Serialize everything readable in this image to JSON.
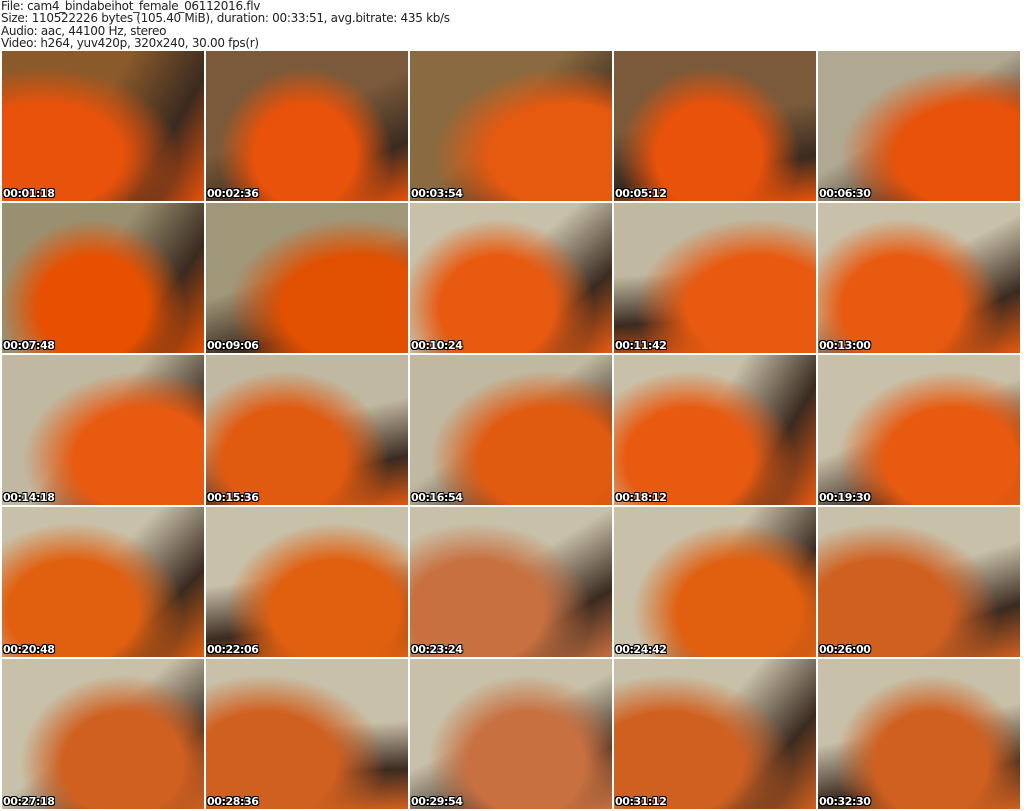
{
  "info": {
    "file": "File: cam4_bindabeihot_female_06112016.flv",
    "size": "Size: 110522226 bytes (105.40 MiB), duration: 00:33:51, avg.bitrate: 435 kb/s",
    "audio": "Audio: aac, 44100 Hz, stereo",
    "video": "Video: h264, yuv420p, 320x240, 30.00 fps(r)"
  },
  "thumbnails": [
    {
      "time": "00:01:18",
      "bg": "#8a5a2a",
      "fg": "#e8520a"
    },
    {
      "time": "00:02:36",
      "bg": "#7a5a3a",
      "fg": "#e8520a"
    },
    {
      "time": "00:03:54",
      "bg": "#8a6a40",
      "fg": "#e65a10"
    },
    {
      "time": "00:05:12",
      "bg": "#7a5a3a",
      "fg": "#e8520a"
    },
    {
      "time": "00:06:30",
      "bg": "#b0a890",
      "fg": "#e8520a"
    },
    {
      "time": "00:07:48",
      "bg": "#9a9070",
      "fg": "#e65000"
    },
    {
      "time": "00:09:06",
      "bg": "#a09678",
      "fg": "#e05000"
    },
    {
      "time": "00:10:24",
      "bg": "#c8c0a8",
      "fg": "#e85a10"
    },
    {
      "time": "00:11:42",
      "bg": "#c0b8a0",
      "fg": "#e85a10"
    },
    {
      "time": "00:13:00",
      "bg": "#c8c0a8",
      "fg": "#e85a10"
    },
    {
      "time": "00:14:18",
      "bg": "#c0b8a0",
      "fg": "#e85a10"
    },
    {
      "time": "00:15:36",
      "bg": "#c0b8a0",
      "fg": "#e05a10"
    },
    {
      "time": "00:16:54",
      "bg": "#c0b8a0",
      "fg": "#e05a10"
    },
    {
      "time": "00:18:12",
      "bg": "#c8c0a8",
      "fg": "#e85a10"
    },
    {
      "time": "00:19:30",
      "bg": "#c8c0a8",
      "fg": "#e85a10"
    },
    {
      "time": "00:20:48",
      "bg": "#c8c0a8",
      "fg": "#e06010"
    },
    {
      "time": "00:22:06",
      "bg": "#c8c0a8",
      "fg": "#e06010"
    },
    {
      "time": "00:23:24",
      "bg": "#c8c0a8",
      "fg": "#c87040"
    },
    {
      "time": "00:24:42",
      "bg": "#c8c0a8",
      "fg": "#e06010"
    },
    {
      "time": "00:26:00",
      "bg": "#c8c0a8",
      "fg": "#d06020"
    },
    {
      "time": "00:27:18",
      "bg": "#c8c0a8",
      "fg": "#d06020"
    },
    {
      "time": "00:28:36",
      "bg": "#c8c0a8",
      "fg": "#d06020"
    },
    {
      "time": "00:29:54",
      "bg": "#c8c0a8",
      "fg": "#c87040"
    },
    {
      "time": "00:31:12",
      "bg": "#c8c0a8",
      "fg": "#d06020"
    },
    {
      "time": "00:32:30",
      "bg": "#c8c0a8",
      "fg": "#d06020"
    }
  ]
}
